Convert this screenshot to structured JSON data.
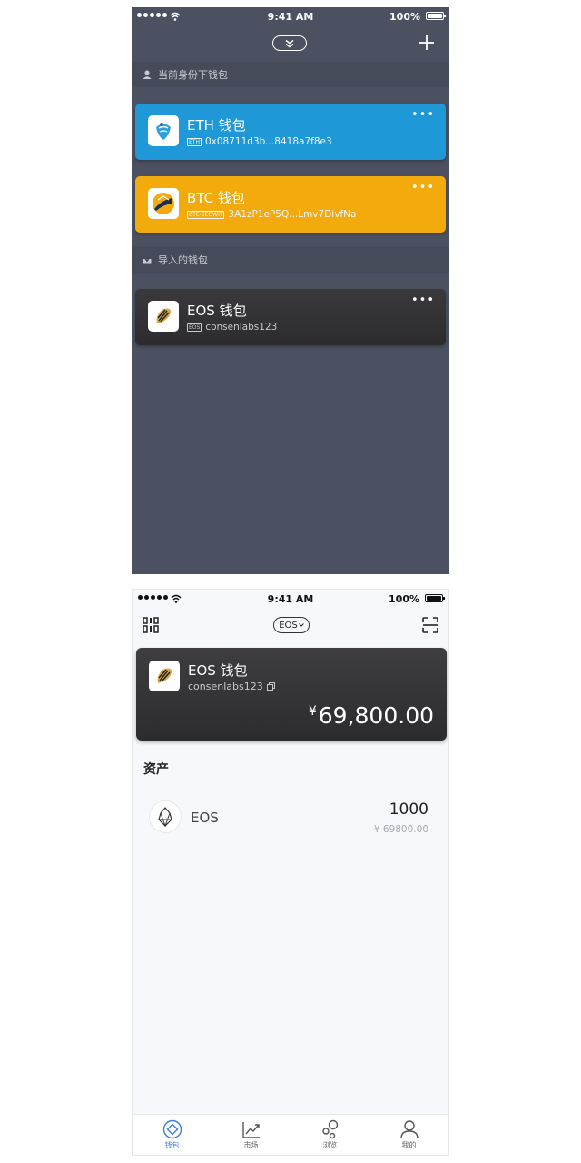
{
  "status_bar": {
    "time": "9:41 AM",
    "battery": "100%"
  },
  "wallet_list": {
    "section_current": "当前身份下钱包",
    "section_imported": "导入的钱包",
    "wallets": [
      {
        "name": "ETH 钱包",
        "tag": "ETH",
        "address": "0x08711d3b...8418a7f8e3",
        "color": "#1e98d6"
      },
      {
        "name": "BTC 钱包",
        "tag": "BTC-SEGWIT",
        "address": "3A1zP1eP5Q...Lmv7DivfNa",
        "color": "#f2aa0c"
      },
      {
        "name": "EOS 钱包",
        "tag": "EOS",
        "address": "consenlabs123",
        "color": "#323133"
      }
    ],
    "more_label": "•••"
  },
  "wallet_detail": {
    "chain": "EOS",
    "wallet_name": "EOS 钱包",
    "account": "consenlabs123",
    "currency_symbol": "¥",
    "balance": "69,800.00",
    "assets_title": "资产",
    "assets": [
      {
        "symbol": "EOS",
        "quantity": "1000",
        "value": "¥ 69800.00"
      }
    ]
  },
  "tab_bar": {
    "tabs": [
      {
        "label": "钱包",
        "icon": "wallet-icon",
        "active": true
      },
      {
        "label": "市场",
        "icon": "market-icon",
        "active": false
      },
      {
        "label": "浏览",
        "icon": "browse-icon",
        "active": false
      },
      {
        "label": "我的",
        "icon": "profile-icon",
        "active": false
      }
    ]
  },
  "colors": {
    "accent": "#3d7fd6",
    "dark_bg": "#4b5160"
  }
}
